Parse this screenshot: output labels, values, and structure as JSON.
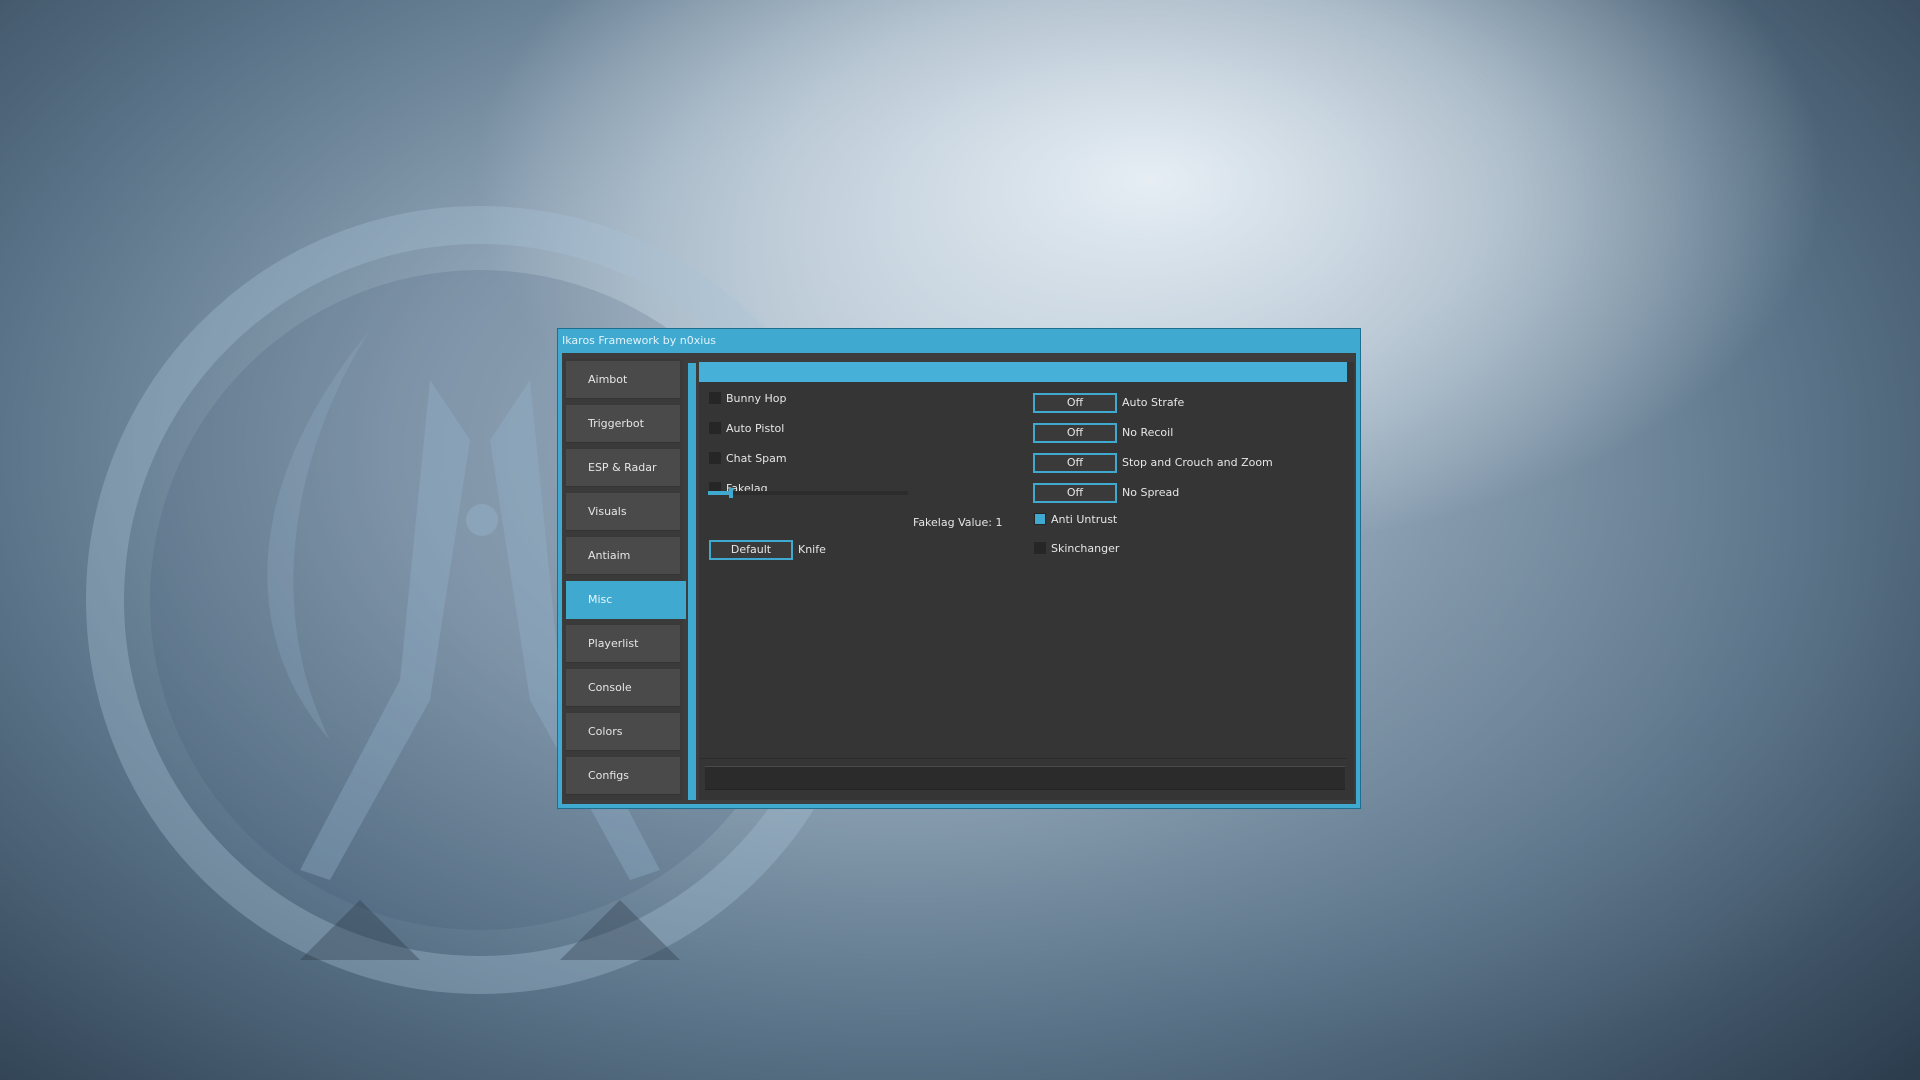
{
  "window": {
    "title": "Ikaros Framework by n0xius",
    "accent_color": "#3fa9d0"
  },
  "sidebar": {
    "active_index": 5,
    "items": [
      {
        "label": "Aimbot"
      },
      {
        "label": "Triggerbot"
      },
      {
        "label": "ESP & Radar"
      },
      {
        "label": "Visuals"
      },
      {
        "label": "Antiaim"
      },
      {
        "label": "Misc"
      },
      {
        "label": "Playerlist"
      },
      {
        "label": "Console"
      },
      {
        "label": "Colors"
      },
      {
        "label": "Configs"
      }
    ]
  },
  "misc": {
    "left_checks": [
      {
        "label": "Bunny Hop",
        "checked": false
      },
      {
        "label": "Auto Pistol",
        "checked": false
      },
      {
        "label": "Chat Spam",
        "checked": false
      },
      {
        "label": "Fakelag",
        "checked": false
      }
    ],
    "fakelag": {
      "label": "Fakelag Value: 1",
      "value": 1,
      "min": 0,
      "max": 15
    },
    "knife": {
      "button_label": "Default",
      "label": "Knife"
    },
    "right_toggles": [
      {
        "button_label": "Off",
        "label": "Auto Strafe"
      },
      {
        "button_label": "Off",
        "label": "No Recoil"
      },
      {
        "button_label": "Off",
        "label": "Stop and Crouch and Zoom"
      },
      {
        "button_label": "Off",
        "label": "No Spread"
      }
    ],
    "right_checks": [
      {
        "label": "Anti Untrust",
        "checked": true
      },
      {
        "label": "Skinchanger",
        "checked": false
      }
    ]
  }
}
